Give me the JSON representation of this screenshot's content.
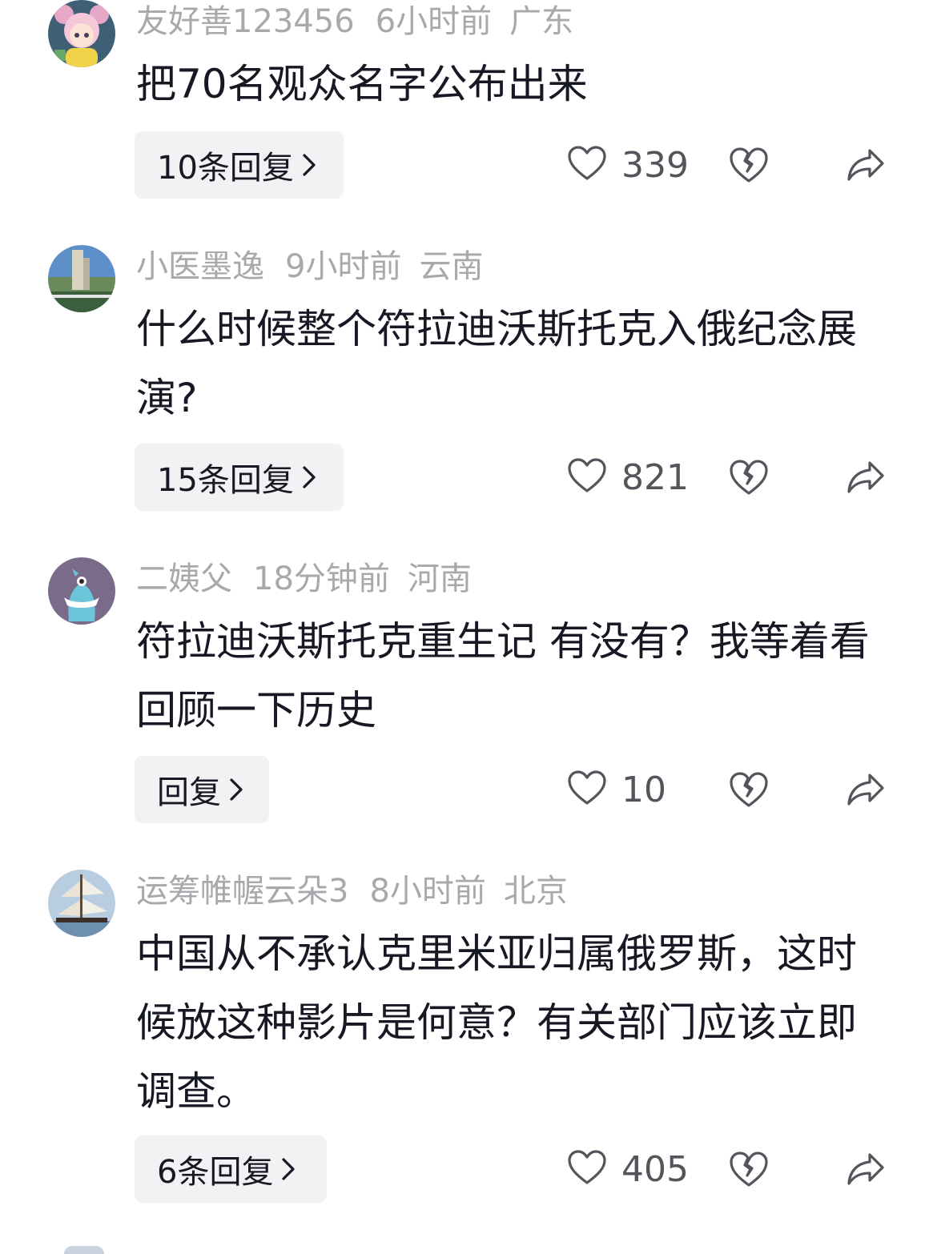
{
  "comments": [
    {
      "username": "友好善123456",
      "time": "6小时前",
      "location": "广东",
      "text": "把70名观众名字公布出来",
      "reply_label": "10条回复",
      "likes": "339"
    },
    {
      "username": "小医墨逸",
      "time": "9小时前",
      "location": "云南",
      "text": "什么时候整个符拉迪沃斯托克入俄纪念展演?",
      "reply_label": "15条回复",
      "likes": "821"
    },
    {
      "username": "二姨父",
      "time": "18分钟前",
      "location": "河南",
      "text": "符拉迪沃斯托克重生记 有没有？我等着看 回顾一下历史",
      "reply_label": "回复",
      "likes": "10"
    },
    {
      "username": "运筹帷幄云朵3",
      "time": "8小时前",
      "location": "北京",
      "text": "中国从不承认克里米亚归属俄罗斯，这时候放这种影片是何意？有关部门应该立即调查。",
      "reply_label": "6条回复",
      "likes": "405"
    }
  ],
  "icons": {
    "like": "heart-outline-icon",
    "dislike": "broken-heart-icon",
    "share": "share-arrow-icon",
    "reply_more": "chevron-right-icon"
  },
  "colors": {
    "meta_text": "#a8a8ad",
    "body_text": "#161823",
    "reply_bg": "#f2f2f4",
    "icon": "#54545c"
  }
}
